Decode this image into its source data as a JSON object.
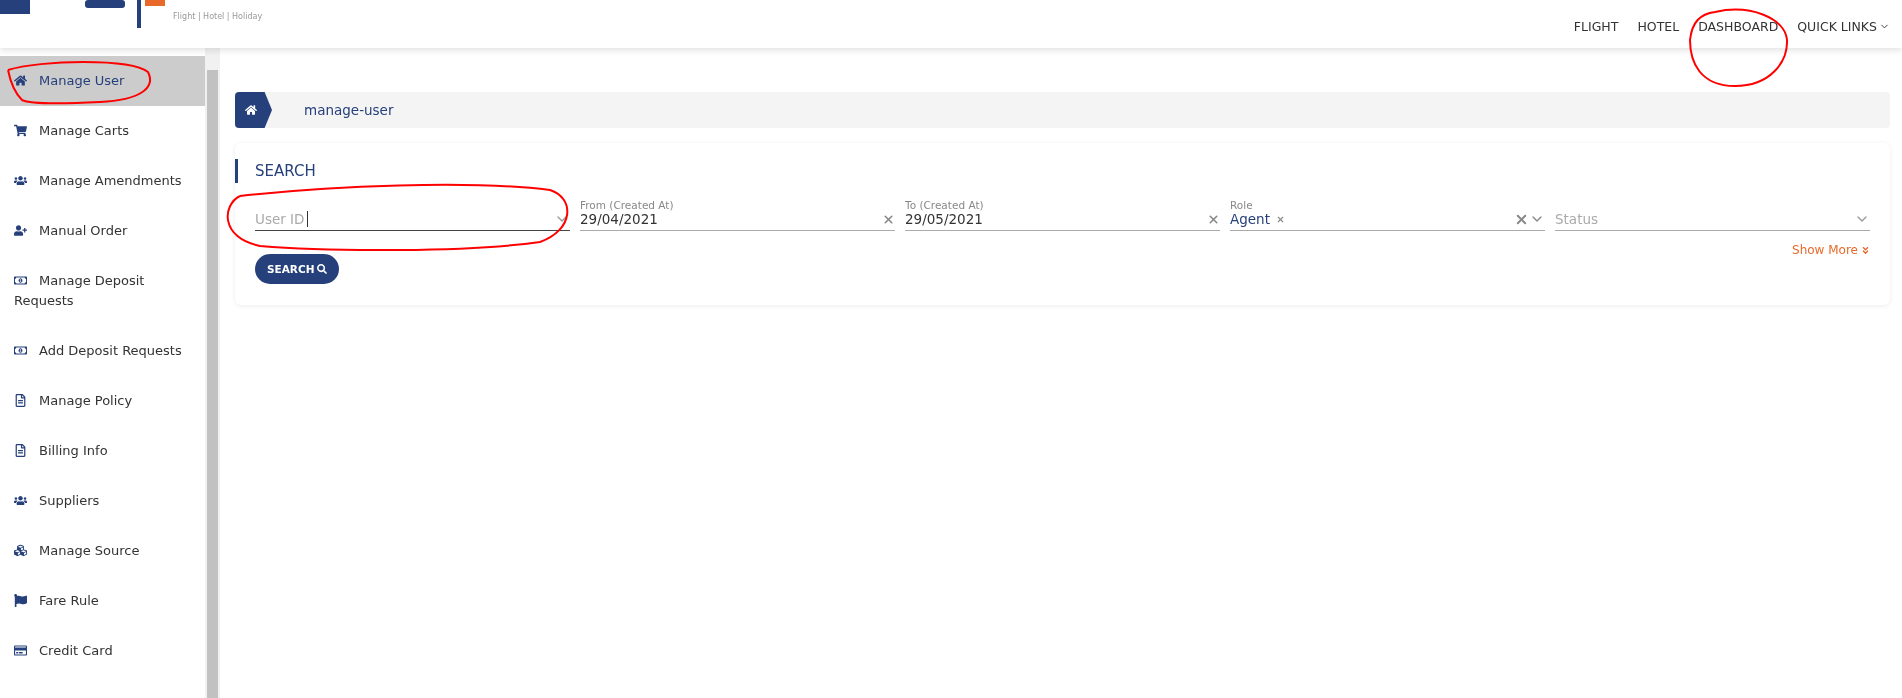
{
  "header": {
    "logo_tagline": "Flight | Hotel | Holiday",
    "nav": [
      {
        "label": "FLIGHT",
        "kind": "link"
      },
      {
        "label": "HOTEL",
        "kind": "link"
      },
      {
        "label": "DASHBOARD",
        "kind": "link"
      },
      {
        "label": "QUICK LINKS",
        "kind": "dropdown"
      }
    ]
  },
  "sidebar": {
    "items": [
      {
        "label": "Manage User",
        "selected": true
      },
      {
        "label": "Manage Carts",
        "selected": false
      },
      {
        "label": "Manage Amendments",
        "selected": false
      },
      {
        "label": "Manual Order",
        "selected": false
      },
      {
        "label": "Manage Deposit Requests",
        "selected": false
      },
      {
        "label": "Add Deposit Requests",
        "selected": false
      },
      {
        "label": "Manage Policy",
        "selected": false
      },
      {
        "label": "Billing Info",
        "selected": false
      },
      {
        "label": "Suppliers",
        "selected": false
      },
      {
        "label": "Manage Source",
        "selected": false
      },
      {
        "label": "Fare Rule",
        "selected": false
      },
      {
        "label": "Credit Card",
        "selected": false
      }
    ]
  },
  "breadcrumb": {
    "current": "manage-user"
  },
  "search": {
    "title": "SEARCH",
    "fields": [
      {
        "kind": "select",
        "placeholder": "User ID"
      },
      {
        "kind": "date",
        "label": "From (Created At)",
        "value": "29/04/2021"
      },
      {
        "kind": "date",
        "label": "To (Created At)",
        "value": "29/05/2021"
      },
      {
        "kind": "multiselect",
        "label": "Role",
        "tags": [
          "Agent"
        ]
      },
      {
        "kind": "select",
        "placeholder": "Status"
      }
    ],
    "show_more": "Show More",
    "button": "SEARCH"
  }
}
